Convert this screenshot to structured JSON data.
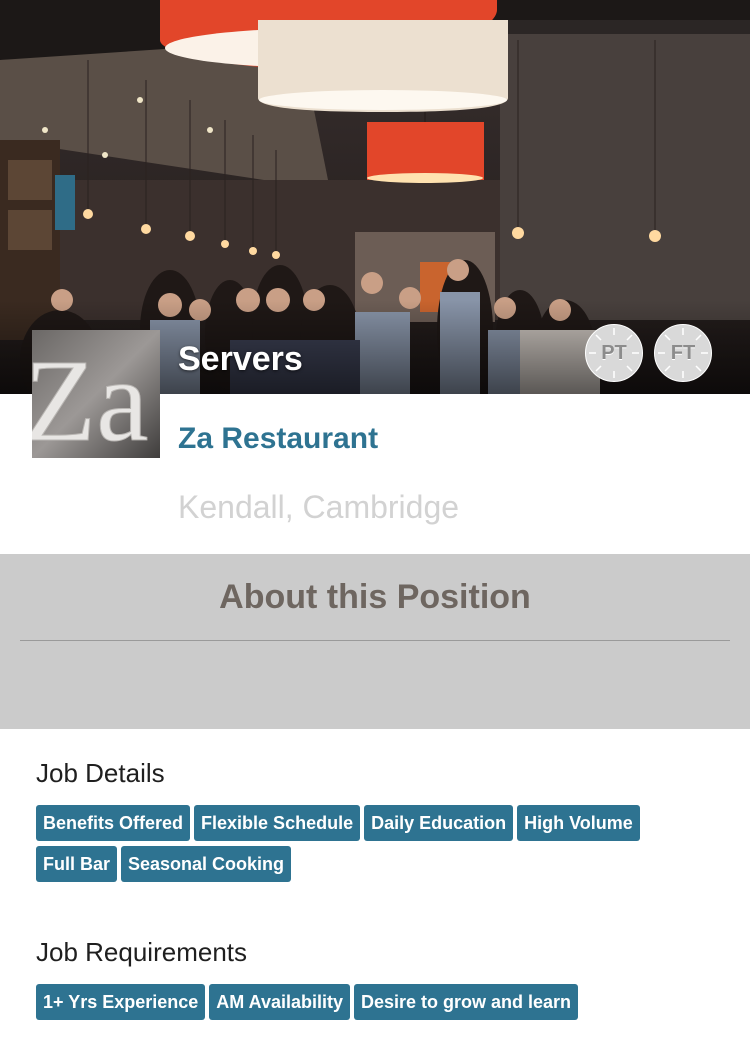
{
  "job": {
    "title": "Servers",
    "badges": [
      "PT",
      "FT"
    ]
  },
  "restaurant": {
    "name": "Za Restaurant",
    "location": "Kendall, Cambridge",
    "logo_text": "Za"
  },
  "about": {
    "title": "About this Position"
  },
  "job_details": {
    "title": "Job Details",
    "tags": [
      "Benefits Offered",
      "Flexible Schedule",
      "Daily Education",
      "High Volume",
      "Full Bar",
      "Seasonal Cooking"
    ]
  },
  "job_requirements": {
    "title": "Job Requirements",
    "tags": [
      "1+ Yrs Experience",
      "AM Availability",
      "Desire to grow and learn"
    ]
  },
  "colors": {
    "accent": "#2e7391",
    "about_bg": "#cbcbcb",
    "location_text": "#d2d2d2"
  }
}
